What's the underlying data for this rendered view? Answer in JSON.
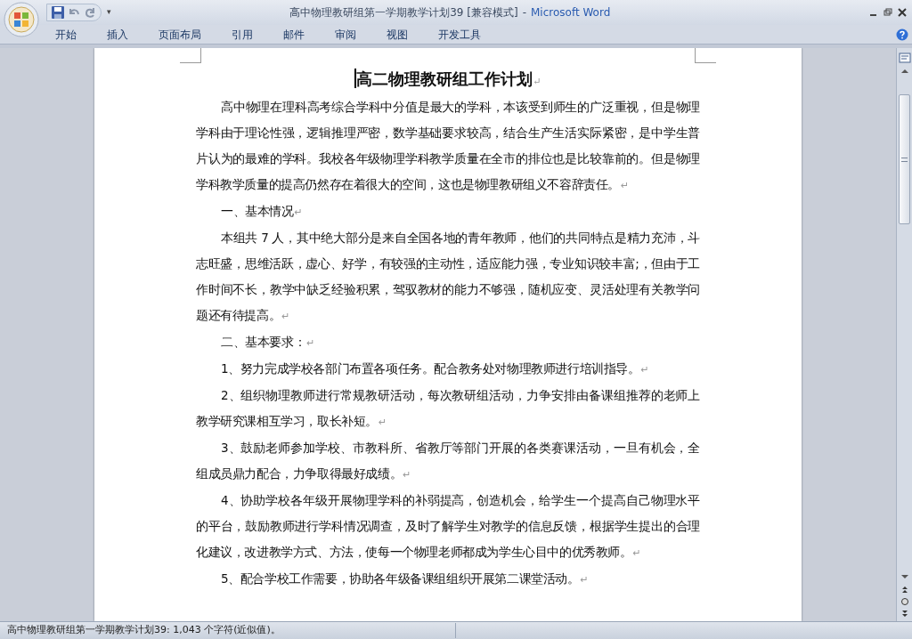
{
  "window": {
    "document_title": "高中物理教研组第一学期教学计划39 [兼容模式]",
    "separator": "-",
    "app_name": "Microsoft Word"
  },
  "quick_access": {
    "customize": "▾"
  },
  "ribbon_tabs": [
    {
      "label": "开始",
      "selected": false
    },
    {
      "label": "插入",
      "selected": false
    },
    {
      "label": "页面布局",
      "selected": false
    },
    {
      "label": "引用",
      "selected": false
    },
    {
      "label": "邮件",
      "selected": false
    },
    {
      "label": "审阅",
      "selected": false
    },
    {
      "label": "视图",
      "selected": false
    },
    {
      "label": "开发工具",
      "selected": false
    }
  ],
  "document": {
    "title": "高二物理教研组工作计划",
    "title_mark": "↵",
    "paragraphs": [
      {
        "kind": "body",
        "text": "高中物理在理科高考综合学科中分值是最大的学科，本该受到师生的广泛重视，但是物理学科由于理论性强，逻辑推理严密，数学基础要求较高，结合生产生活实际紧密，是中学生普片认为的最难的学科。我校各年级物理学科教学质量在全市的排位也是比较靠前的。但是物理学科教学质量的提高仍然存在着很大的空间，这也是物理教研组义不容辞责任。",
        "mark": "↵"
      },
      {
        "kind": "heading",
        "text": "一、基本情况",
        "mark": "↵"
      },
      {
        "kind": "body",
        "text": " 本组共 7 人，其中绝大部分是来自全国各地的青年教师，他们的共同特点是精力充沛，斗志旺盛，思维活跃，虚心、好学，有较强的主动性，适应能力强，专业知识较丰富;，但由于工作时间不长，教学中缺乏经验积累，驾驭教材的能力不够强，随机应变、灵活处理有关教学问题还有待提高。",
        "mark": "↵"
      },
      {
        "kind": "heading",
        "text": "二、基本要求：",
        "mark": "↵"
      },
      {
        "kind": "body",
        "text": "1、努力完成学校各部门布置各项任务。配合教务处对物理教师进行培训指导。",
        "mark": "↵"
      },
      {
        "kind": "body",
        "text": "2、组织物理教师进行常规教研活动，每次教研组活动，力争安排由备课组推荐的老师上教学研究课相互学习，取长补短。",
        "mark": "↵"
      },
      {
        "kind": "body",
        "text": "3、鼓励老师参加学校、市教科所、省教厅等部门开展的各类赛课活动，一旦有机会，全组成员鼎力配合，力争取得最好成绩。",
        "mark": "↵"
      },
      {
        "kind": "body",
        "text": "4、协助学校各年级开展物理学科的补弱提高，创造机会，给学生一个提高自己物理水平的平台，鼓励教师进行学科情况调查，及时了解学生对教学的信息反馈，根据学生提出的合理化建议，改进教学方式、方法，使每一个物理老师都成为学生心目中的优秀教师。",
        "mark": "↵"
      },
      {
        "kind": "body",
        "text": "5、配合学校工作需要，协助各年级备课组组织开展第二课堂活动。",
        "mark": "↵"
      }
    ]
  },
  "status_bar": {
    "text": "高中物理教研组第一学期教学计划39: 1,043 个字符(近似值)。"
  }
}
